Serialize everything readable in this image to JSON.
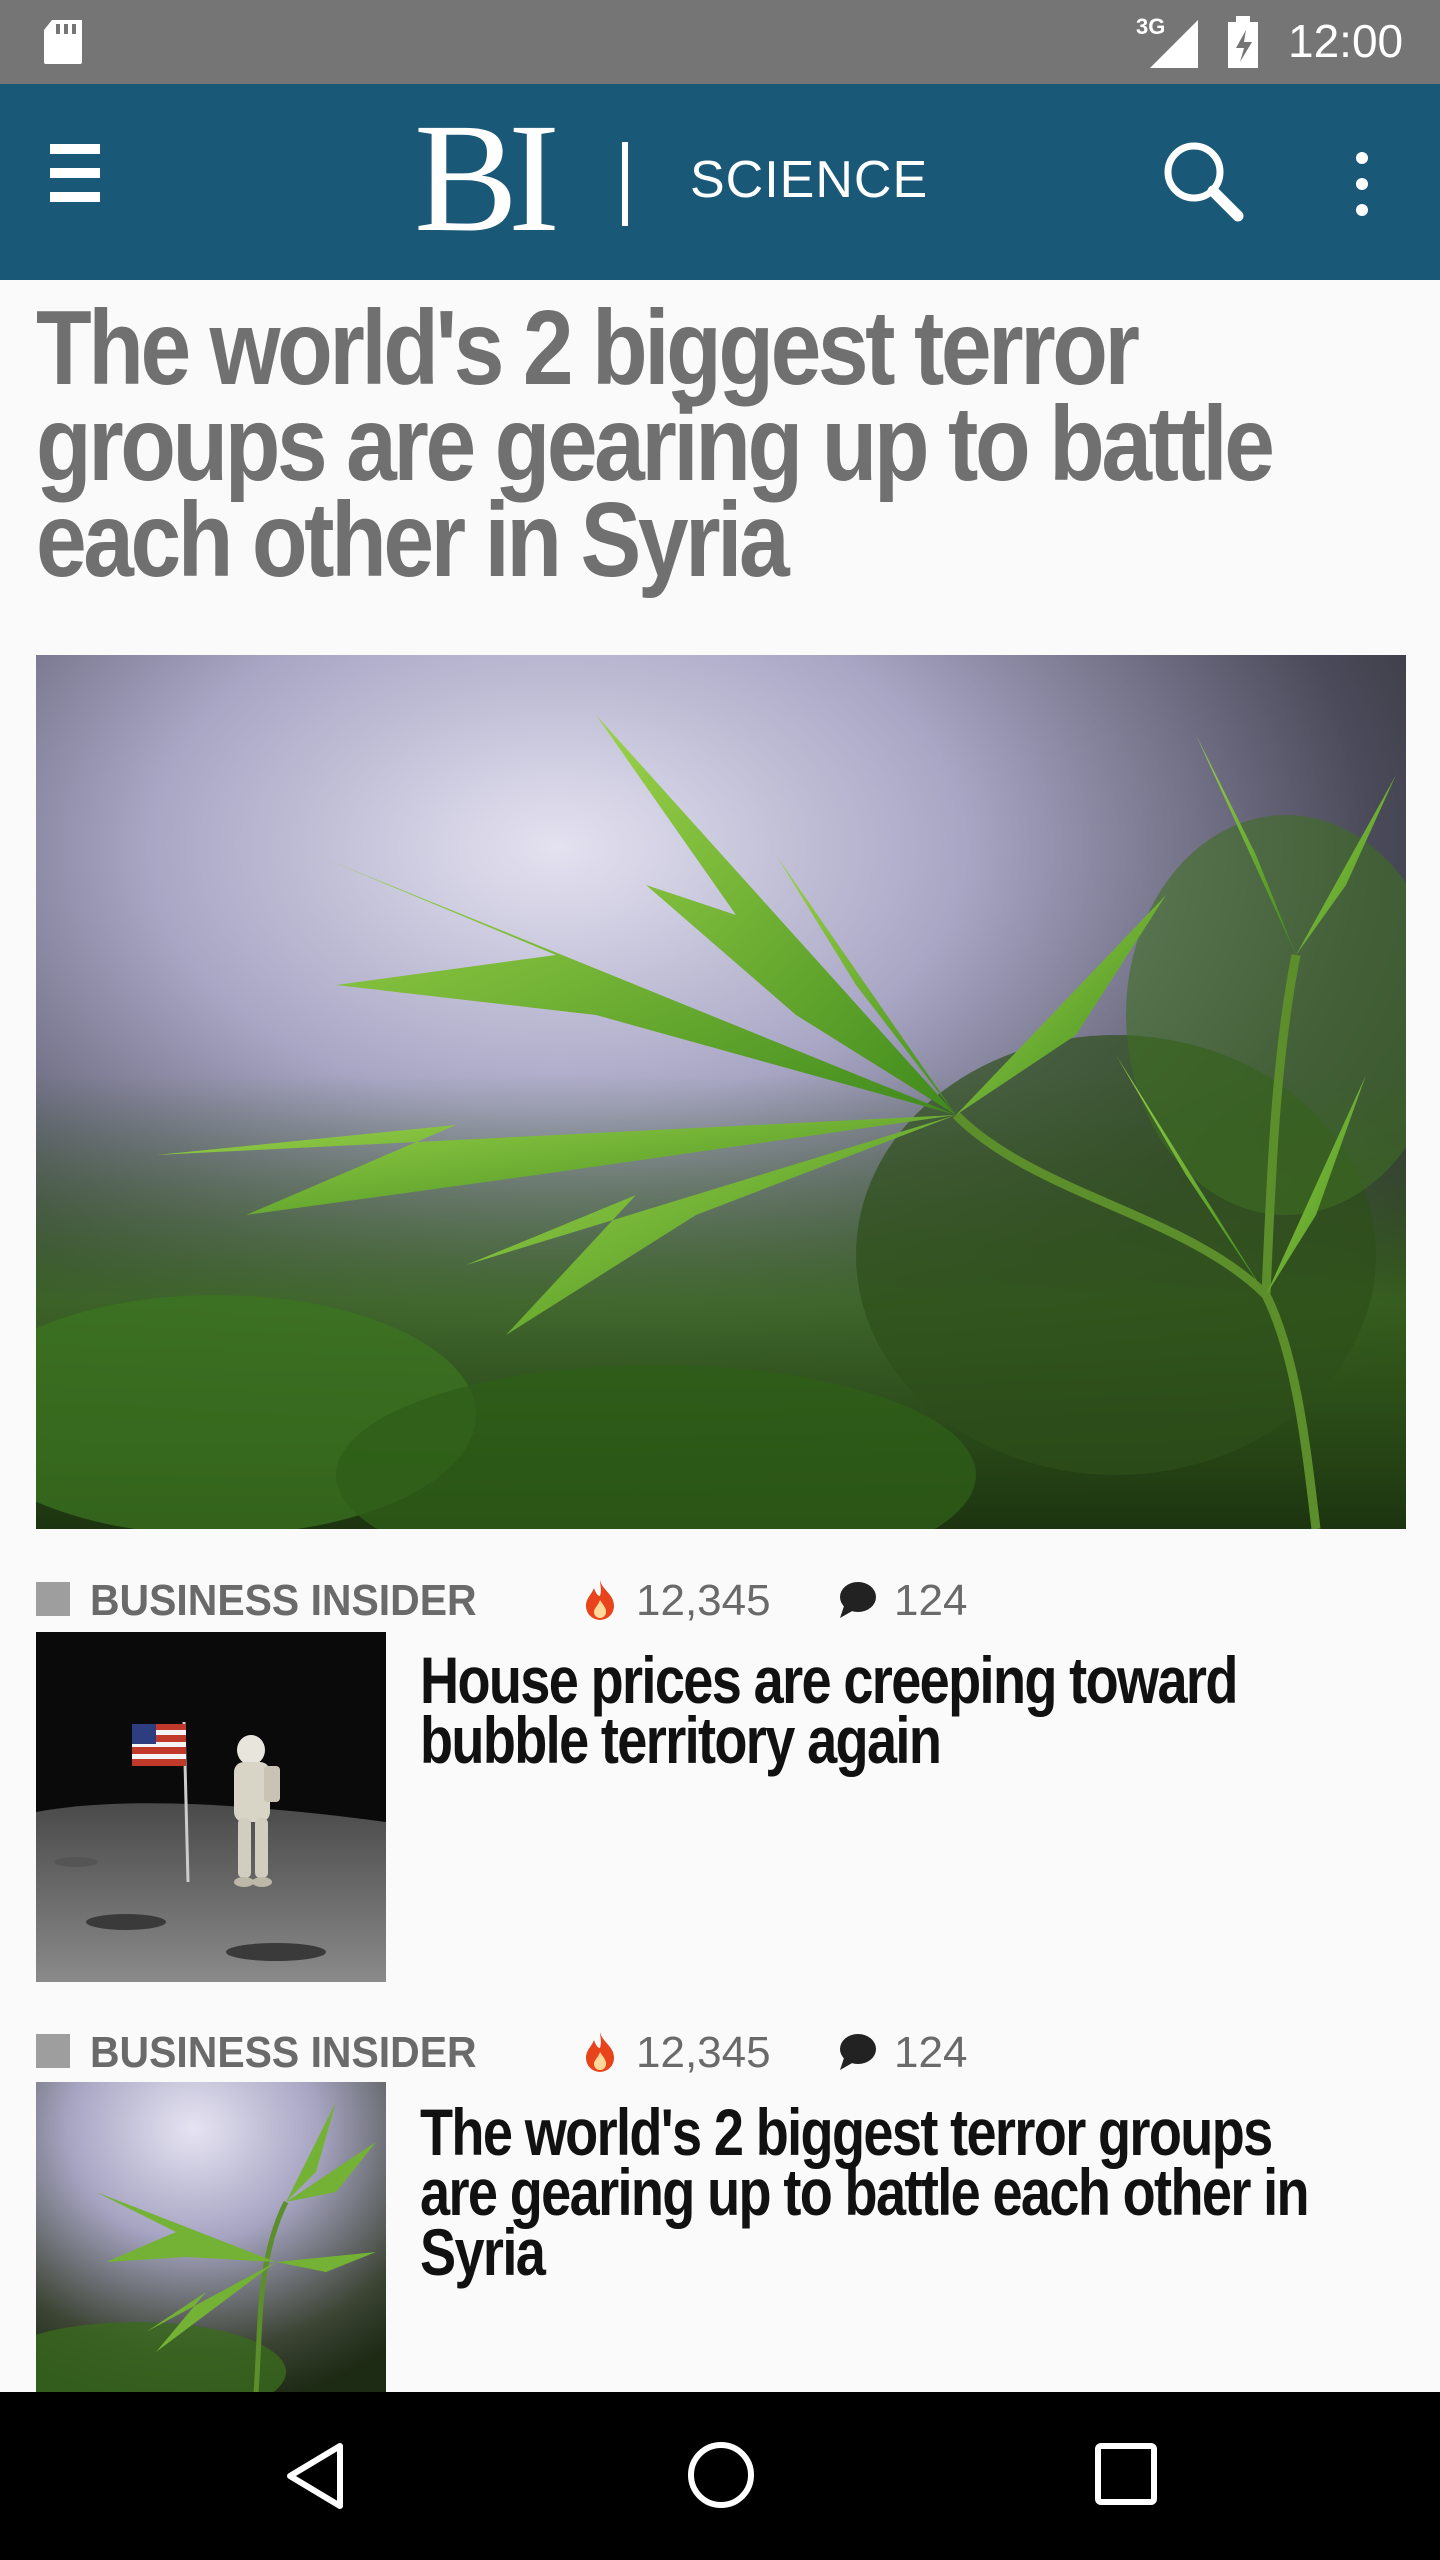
{
  "status_bar": {
    "network": "3G",
    "time": "12:00",
    "icons": [
      "sd-card-icon",
      "signal-icon",
      "battery-charging-icon"
    ]
  },
  "app_bar": {
    "logo": "BI",
    "section": "SCIENCE",
    "icons": [
      "hamburger-menu-icon",
      "search-icon",
      "overflow-menu-icon"
    ],
    "background_color": "#1a5877"
  },
  "feature": {
    "headline_lines": [
      "The world's 2 biggest terror",
      "groups are gearing up to battle",
      "each other in Syria"
    ],
    "image": "cannabis-plant-photo"
  },
  "stories": [
    {
      "source": "BUSINESS INSIDER",
      "views": "12,345",
      "comments": "124",
      "title_lines": [
        "House prices are creeping toward",
        "bubble territory again"
      ],
      "thumbnail": "astronaut-moon-flag-photo"
    },
    {
      "source": "BUSINESS INSIDER",
      "views": "12,345",
      "comments": "124",
      "title_lines": [
        "The world's 2 biggest terror groups",
        "are gearing up to battle each other in",
        "Syria"
      ],
      "thumbnail": "cannabis-plant-photo"
    }
  ],
  "nav_bar": {
    "icons": [
      "back-icon",
      "home-icon",
      "recent-apps-icon"
    ]
  },
  "colors": {
    "accent_fire": "#e8431a",
    "headline_gray": "#707070",
    "meta_gray": "#6a6a6a"
  }
}
